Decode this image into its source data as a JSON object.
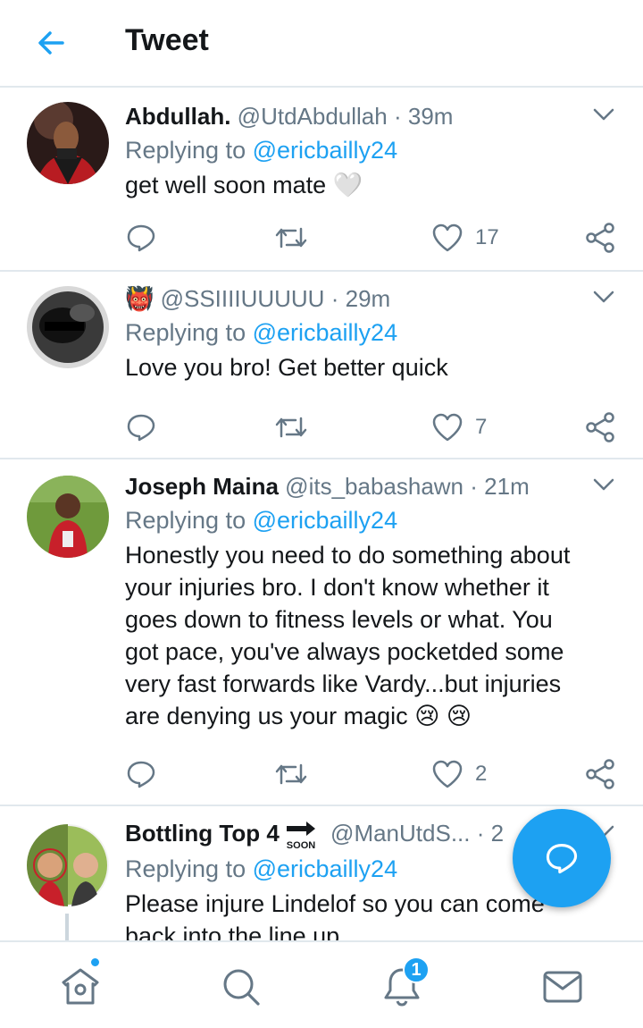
{
  "header": {
    "title": "Tweet"
  },
  "reply_prefix": "Replying to",
  "tweets": [
    {
      "name": "Abdullah.",
      "handle": "@UtdAbdullah",
      "dot": "·",
      "time": "39m",
      "replying_to": "@ericbailly24",
      "text": "get well soon mate",
      "emoji_after_text": "🤍",
      "likes": "17"
    },
    {
      "name": "",
      "name_emoji": "👹",
      "handle": "@SSIIIIUUUUU",
      "dot": "·",
      "time": "29m",
      "replying_to": "@ericbailly24",
      "text": "Love you bro! Get better quick",
      "likes": "7"
    },
    {
      "name": "Joseph Maina",
      "handle": "@its_babashawn",
      "dot": "·",
      "time": "21m",
      "replying_to": "@ericbailly24",
      "text": "Honestly you need to do something about your injuries bro.  I don't know whether it goes down to fitness levels or what.  You got pace, you've always pocketded some very fast forwards like Vardy...but injuries are denying us your magic",
      "emoji_after_text": "😢 😢",
      "likes": "2"
    },
    {
      "name": "Bottling Top 4",
      "name_badge": "SOON",
      "handle": "@ManUtdS...",
      "dot": "·",
      "time": "2",
      "replying_to": "@ericbailly24",
      "text": "Please injure Lindelof so you can come back into the line up"
    }
  ],
  "bottom_nav": {
    "notifications_count": "1",
    "items": [
      "home-icon",
      "search-icon",
      "notifications-icon",
      "messages-icon"
    ]
  },
  "colors": {
    "accent": "#1da1f2",
    "text": "#14171a",
    "secondary": "#657786",
    "divider": "#e1e8ed"
  }
}
